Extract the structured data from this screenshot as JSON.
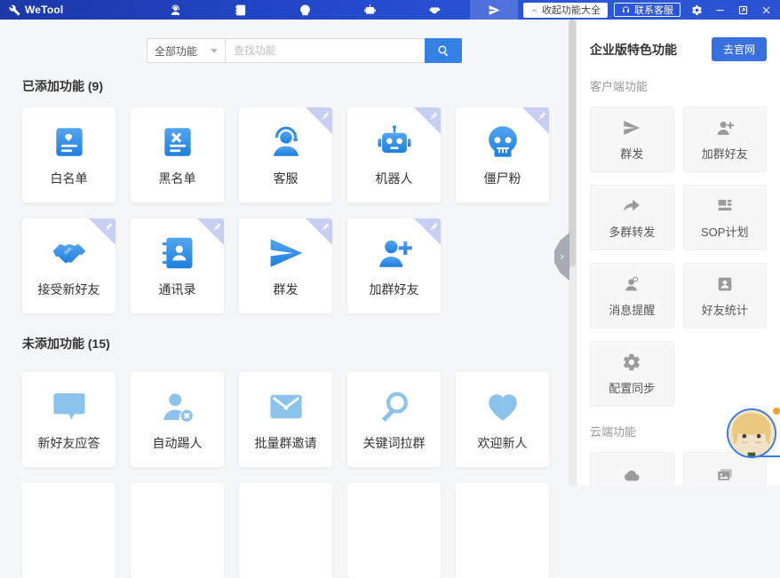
{
  "topbar": {
    "app_name": "WeTool",
    "collapse_button_label": "收起功能大全",
    "support_button_label": "联系客服",
    "pinned_shortcuts": [
      {
        "icon": "support-person-icon"
      },
      {
        "icon": "contact-book-icon"
      },
      {
        "icon": "skull-icon"
      },
      {
        "icon": "robot-icon"
      },
      {
        "icon": "handshake-icon"
      },
      {
        "icon": "paper-plane-icon",
        "active": true
      }
    ],
    "window_controls": [
      "settings-icon",
      "minimize-icon",
      "restore-icon",
      "close-icon"
    ]
  },
  "search": {
    "category_selector": "全部功能",
    "placeholder": "查找功能"
  },
  "main": {
    "added": {
      "title": "已添加功能 (9)",
      "items": [
        {
          "label": "白名单",
          "icon": "card-heart-icon",
          "pinned": false
        },
        {
          "label": "黑名单",
          "icon": "card-x-icon",
          "pinned": false
        },
        {
          "label": "客服",
          "icon": "support-person-icon",
          "pinned": true
        },
        {
          "label": "机器人",
          "icon": "robot-icon",
          "pinned": true
        },
        {
          "label": "僵尸粉",
          "icon": "skull-icon",
          "pinned": true
        },
        {
          "label": "接受新好友",
          "icon": "handshake-icon",
          "pinned": true
        },
        {
          "label": "通讯录",
          "icon": "contact-book-icon",
          "pinned": true
        },
        {
          "label": "群发",
          "icon": "paper-plane-icon",
          "pinned": true
        },
        {
          "label": "加群好友",
          "icon": "person-plus-icon",
          "pinned": true
        }
      ]
    },
    "not_added": {
      "title": "未添加功能 (15)",
      "items": [
        {
          "label": "新好友应答",
          "icon": "chat-bubble-icon"
        },
        {
          "label": "自动踢人",
          "icon": "person-remove-icon"
        },
        {
          "label": "批量群邀请",
          "icon": "envelope-icon"
        },
        {
          "label": "关键词拉群",
          "icon": "magnifier-icon"
        },
        {
          "label": "欢迎新人",
          "icon": "heart-icon"
        }
      ]
    }
  },
  "sidebar": {
    "title": "企业版特色功能",
    "website_button_label": "去官网",
    "groups": [
      {
        "label": "客户端功能",
        "items": [
          {
            "label": "群发",
            "icon": "paper-plane-icon"
          },
          {
            "label": "加群好友",
            "icon": "person-plus-icon"
          },
          {
            "label": "多群转发",
            "icon": "forward-arrow-icon"
          },
          {
            "label": "SOP计划",
            "icon": "layout-blocks-icon"
          },
          {
            "label": "消息提醒",
            "icon": "message-alert-icon"
          },
          {
            "label": "好友统计",
            "icon": "id-card-icon"
          },
          {
            "label": "配置同步",
            "icon": "gear-icon"
          }
        ]
      },
      {
        "label": "云端功能",
        "items": [
          {
            "label": "",
            "icon": "cloud-icon"
          },
          {
            "label": "",
            "icon": "gallery-icon"
          }
        ]
      }
    ]
  },
  "colors": {
    "topbar_blue": "#2348CB",
    "accent_blue": "#3580E4",
    "icon_blue": "#2F8FE8",
    "icon_light_blue": "#8CC3EC",
    "icon_grey": "#9B9B9B",
    "pin_badge": "#C9CFF2",
    "website_button_blue": "#3A70DD",
    "avatar_ring_blue": "#3E7CDF"
  }
}
